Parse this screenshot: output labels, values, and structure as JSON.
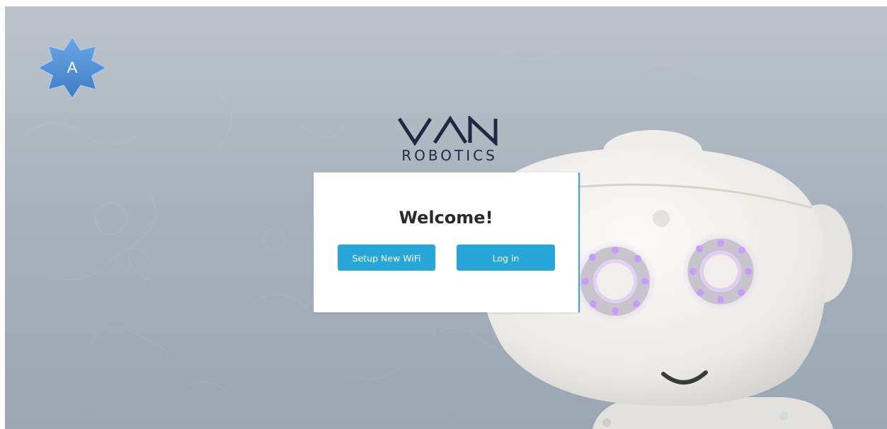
{
  "badge": {
    "label": "A",
    "icon": "star-badge-icon"
  },
  "brand": {
    "mark": "VAN",
    "subtitle": "ROBOTICS"
  },
  "welcome": {
    "title": "Welcome!",
    "wifi_button": "Setup New WiFi",
    "login_button": "Log in"
  },
  "colors": {
    "accent": "#27a6da",
    "logo": "#1d2a44",
    "badge_fill": "#4f8ed0",
    "robot_led": "#b48ef0"
  }
}
